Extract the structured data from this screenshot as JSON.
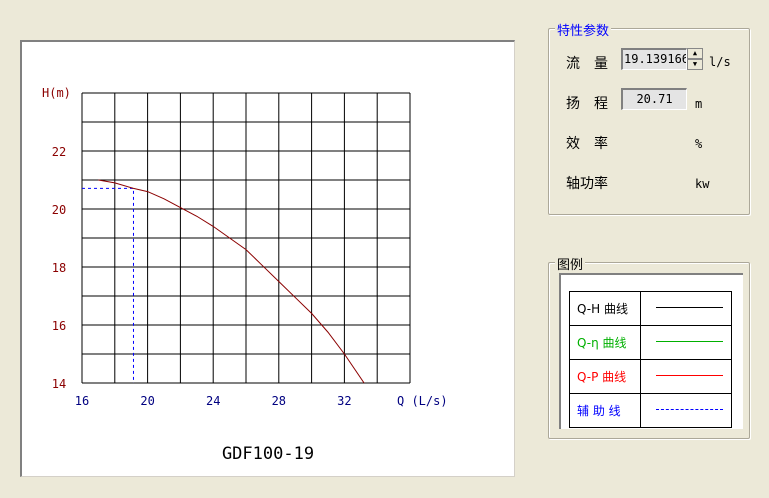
{
  "chart_title": "GDF100-19",
  "chart_data": {
    "type": "line",
    "title": "GDF100-19",
    "xlabel": "Q (L/s)",
    "ylabel": "H(m)",
    "xlim": [
      16,
      36
    ],
    "ylim": [
      14,
      24
    ],
    "x_ticks": [
      "16",
      "20",
      "24",
      "28",
      "32"
    ],
    "y_ticks": [
      "14",
      "16",
      "18",
      "20",
      "22"
    ],
    "grid": true,
    "series": [
      {
        "name": "Q-H 曲线",
        "color": "#8b0000",
        "x": [
          17,
          18,
          19.14,
          20,
          21,
          22,
          23,
          24,
          25,
          26,
          27,
          28,
          29,
          30,
          31,
          32,
          33.2
        ],
        "y": [
          21.0,
          20.9,
          20.71,
          20.6,
          20.35,
          20.05,
          19.75,
          19.4,
          19.0,
          18.6,
          18.05,
          17.5,
          16.95,
          16.4,
          15.75,
          15.0,
          14.0
        ]
      }
    ],
    "guide": {
      "x": 19.139166,
      "y": 20.71,
      "color": "#0000ff"
    }
  },
  "params": {
    "title": "特性参数",
    "flow_label": "流　量",
    "flow_value": "19.139166",
    "flow_unit": "l/s",
    "head_label": "扬　程",
    "head_value": "20.71",
    "head_unit": "m",
    "eff_label": "效　率",
    "eff_unit": "%",
    "power_label": "轴功率",
    "power_unit": "kw"
  },
  "legend": {
    "title": "图例",
    "items": [
      {
        "label": "Q-H 曲线",
        "color": "#000000"
      },
      {
        "label": "Q-η 曲线",
        "color": "#00b000"
      },
      {
        "label": "Q-P 曲线",
        "color": "#ff0000"
      },
      {
        "label": "辅 助 线",
        "color": "#0000ff"
      }
    ]
  }
}
